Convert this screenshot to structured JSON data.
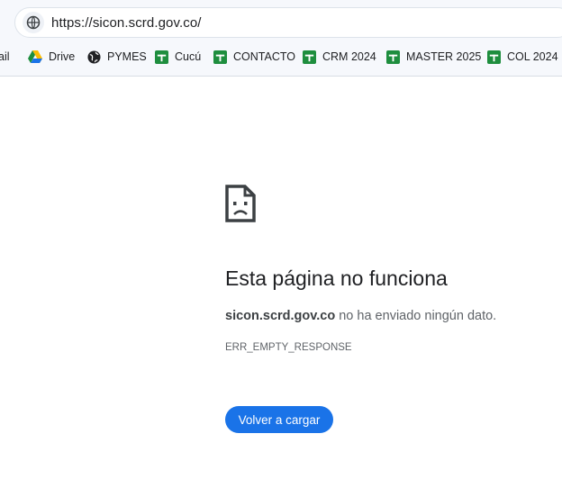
{
  "browser": {
    "url": "https://sicon.scrd.gov.co/",
    "bookmarks": [
      {
        "label": "ail",
        "icon": "gmail-icon"
      },
      {
        "label": "Drive",
        "icon": "google-drive-icon"
      },
      {
        "label": "PYMES",
        "icon": "globe-icon"
      },
      {
        "label": "Cucú",
        "icon": "google-sheets-icon"
      },
      {
        "label": "CONTACTO",
        "icon": "google-sheets-icon"
      },
      {
        "label": "CRM 2024",
        "icon": "google-sheets-icon"
      },
      {
        "label": "MASTER 2025",
        "icon": "google-sheets-icon"
      },
      {
        "label": "COL 2024",
        "icon": "google-sheets-icon"
      }
    ]
  },
  "error_page": {
    "icon": "sad-page-icon",
    "title": "Esta página no funciona",
    "host": "sicon.scrd.gov.co",
    "message": " no ha enviado ningún dato.",
    "error_code": "ERR_EMPTY_RESPONSE",
    "reload_button": "Volver a cargar"
  },
  "colors": {
    "accent": "#1a73e8",
    "sheets_green": "#1e8e3e"
  }
}
